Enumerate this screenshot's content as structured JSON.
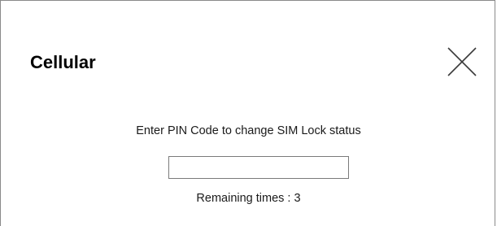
{
  "dialog": {
    "title": "Cellular",
    "close_icon": "close-icon",
    "prompt": "Enter PIN Code to change SIM Lock status",
    "pin_input": {
      "value": "",
      "placeholder": ""
    },
    "remaining": "Remaining times : 3"
  },
  "colors": {
    "background": "#ffffff",
    "border": "#8a8a8a",
    "text": "#1a1a1a",
    "input_border": "#7a7a7a"
  }
}
